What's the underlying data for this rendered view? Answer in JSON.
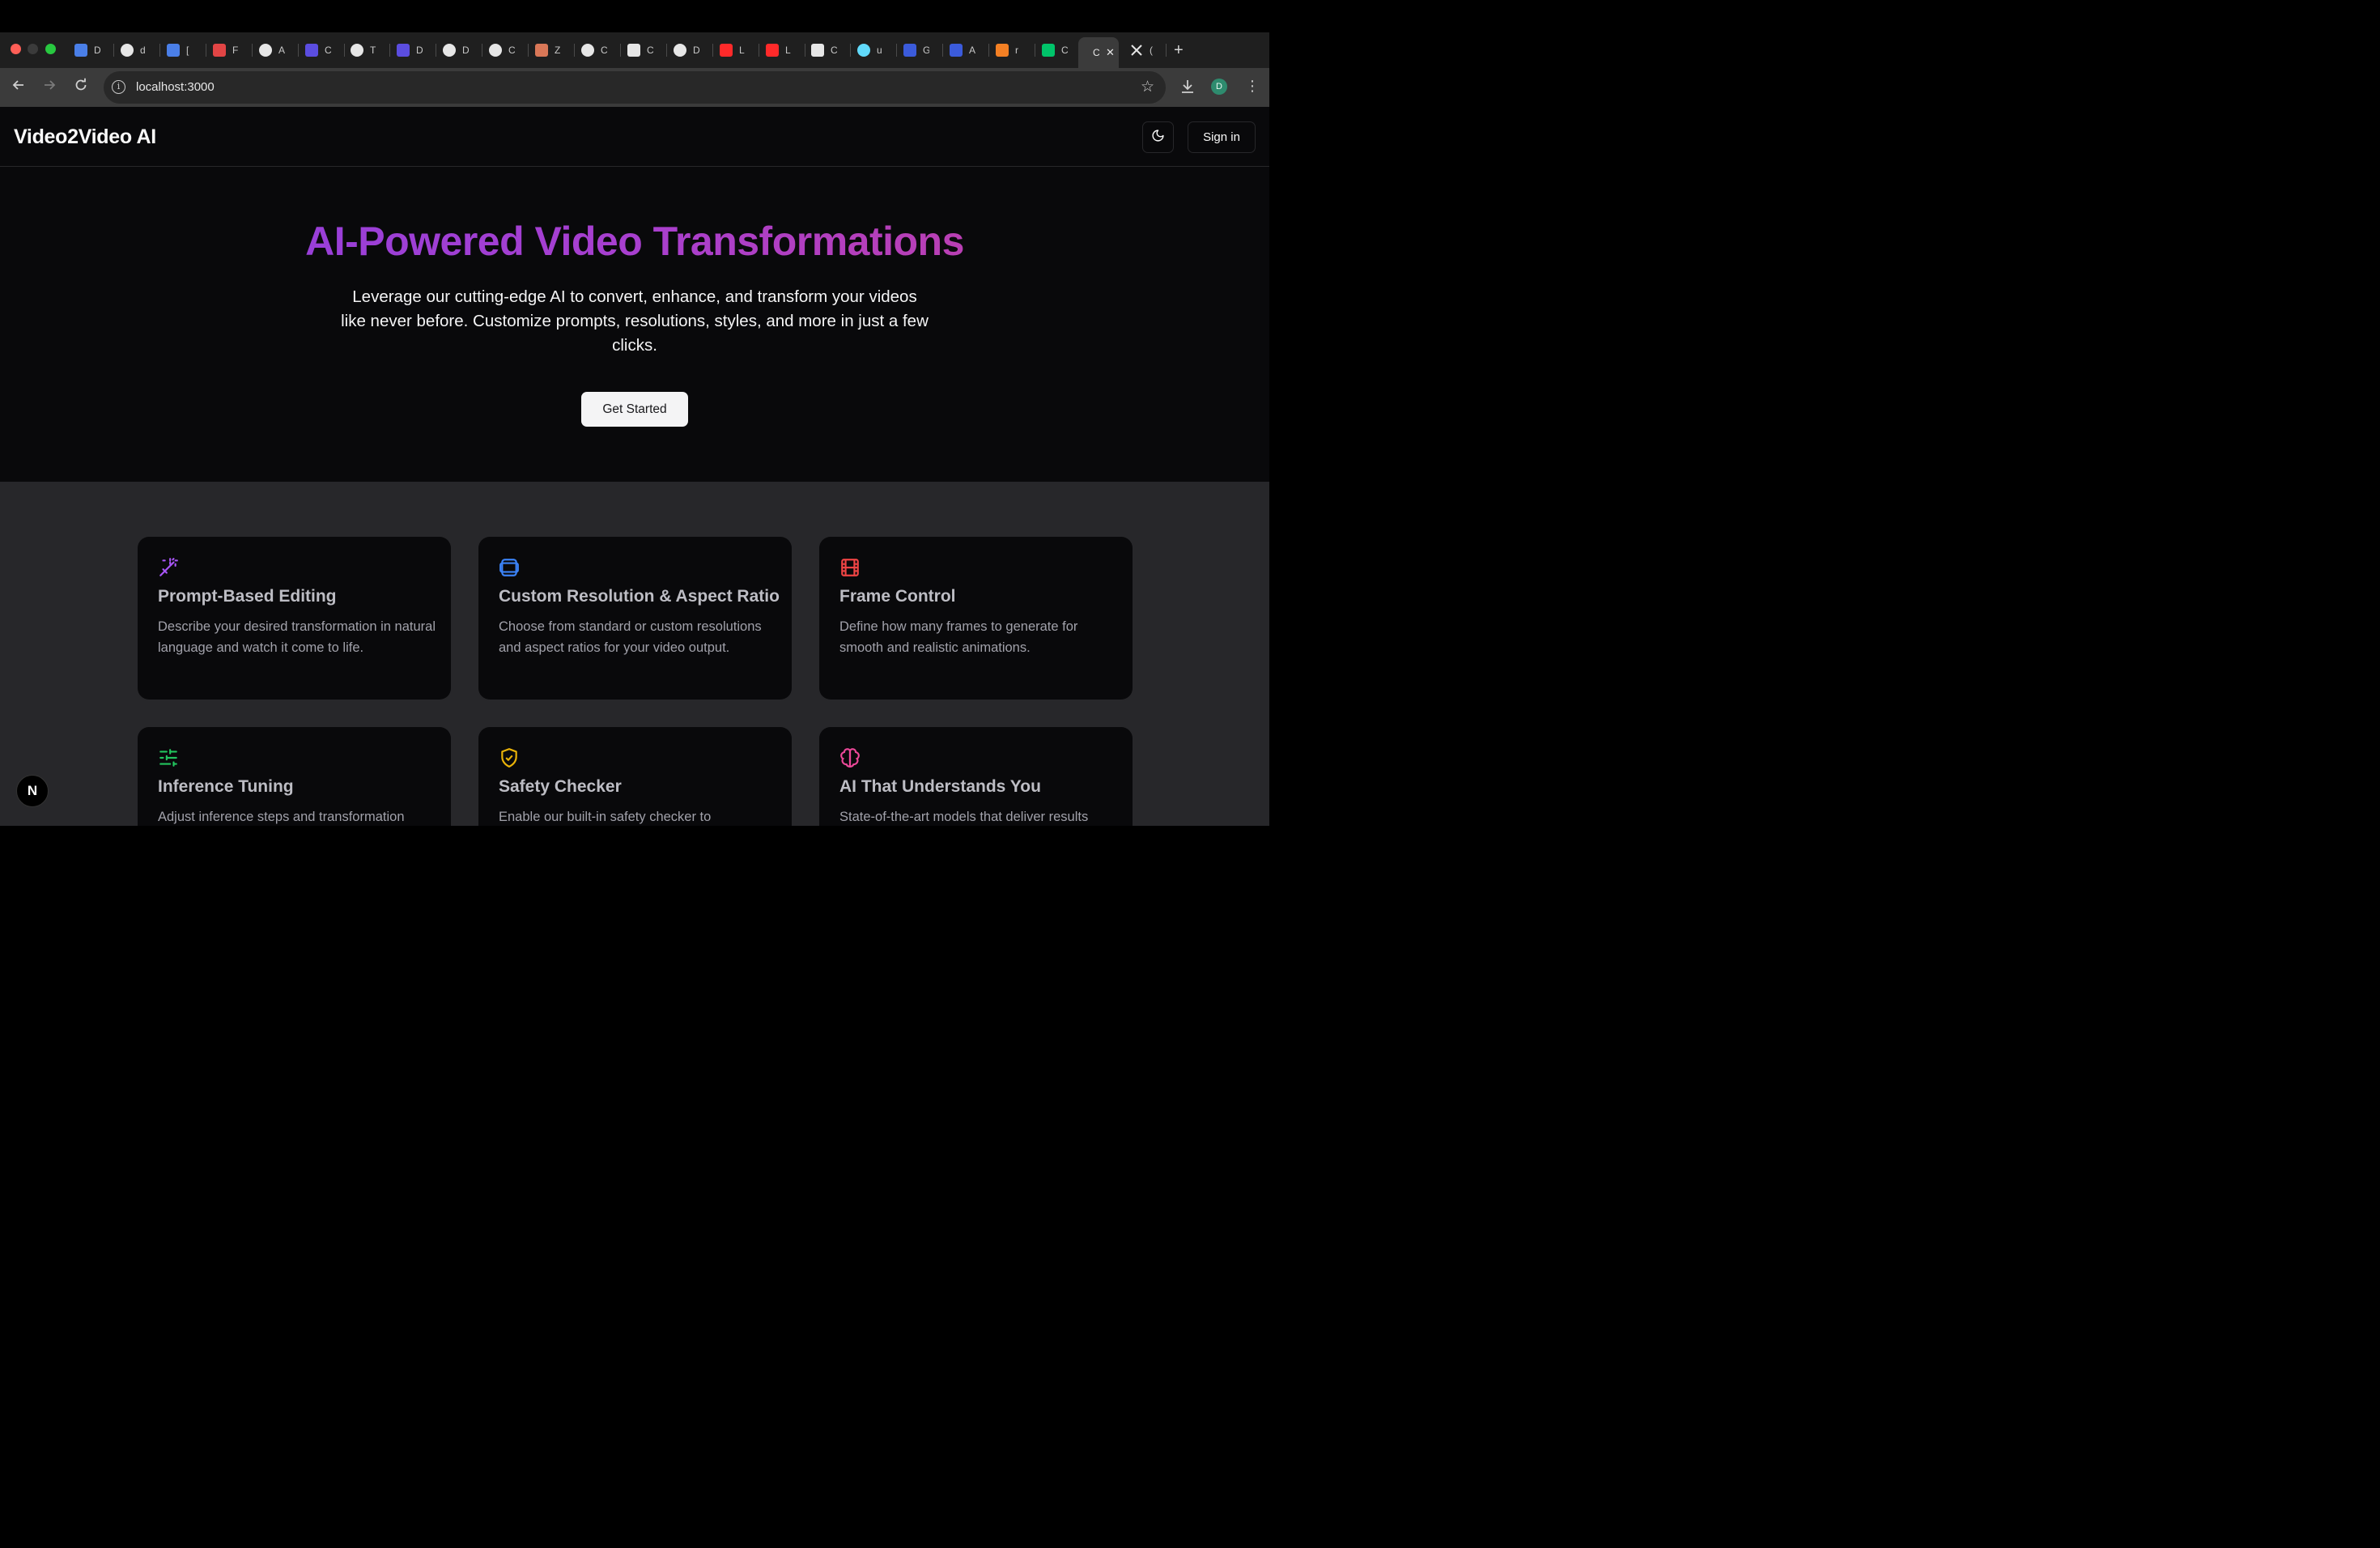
{
  "browser": {
    "tabs": [
      {
        "letter": "D",
        "icon": "docs-icon",
        "color": "#4a7fe8"
      },
      {
        "letter": "d",
        "icon": "github-icon",
        "color": "#e6e6e6"
      },
      {
        "letter": "[",
        "icon": "docs-icon",
        "color": "#4a7fe8"
      },
      {
        "letter": "F",
        "icon": "lifebuoy-icon",
        "color": "#e24545"
      },
      {
        "letter": "A",
        "icon": "openai-icon",
        "color": "#e6e6e6"
      },
      {
        "letter": "C",
        "icon": "copilot-icon",
        "color": "#5b4de0"
      },
      {
        "letter": "T",
        "icon": "cursor-icon",
        "color": "#e6e6e6"
      },
      {
        "letter": "D",
        "icon": "copilot-icon",
        "color": "#5b4de0"
      },
      {
        "letter": "D",
        "icon": "cursor-icon",
        "color": "#e6e6e6"
      },
      {
        "letter": "C",
        "icon": "cursor-icon",
        "color": "#e6e6e6"
      },
      {
        "letter": "Z",
        "icon": "claude-icon",
        "color": "#d97757"
      },
      {
        "letter": "C",
        "icon": "openai-icon",
        "color": "#e6e6e6"
      },
      {
        "letter": "C",
        "icon": "slash-icon",
        "color": "#e6e6e6"
      },
      {
        "letter": "D",
        "icon": "notion-icon",
        "color": "#e6e6e6"
      },
      {
        "letter": "L",
        "icon": "youtube-icon",
        "color": "#ff2a2a"
      },
      {
        "letter": "L",
        "icon": "youtube-icon",
        "color": "#ff2a2a"
      },
      {
        "letter": "C",
        "icon": "cloud-icon",
        "color": "#e6e6e6"
      },
      {
        "letter": "u",
        "icon": "react-icon",
        "color": "#61dafb"
      },
      {
        "letter": "G",
        "icon": "cloud-icon",
        "color": "#3b5bdb"
      },
      {
        "letter": "A",
        "icon": "cloud-icon",
        "color": "#3b5bdb"
      },
      {
        "letter": "r",
        "icon": "stackoverflow-icon",
        "color": "#f48024"
      },
      {
        "letter": "C",
        "icon": "leaf-icon",
        "color": "#00c46a"
      }
    ],
    "active_tab": {
      "letter": "C"
    },
    "after_tab": {
      "letter": "(",
      "icon": "x-icon"
    },
    "url": "localhost:3000",
    "profile_initial": "D"
  },
  "header": {
    "brand": "Video2Video AI",
    "signin_label": "Sign in"
  },
  "hero": {
    "title": "AI-Powered Video Transformations",
    "subtitle": "Leverage our cutting-edge AI to convert, enhance, and transform your videos like never before. Customize prompts, resolutions, styles, and more in just a few clicks.",
    "cta_label": "Get Started"
  },
  "features": [
    {
      "title": "Prompt-Based Editing",
      "description": "Describe your desired transformation in natural language and watch it come to life.",
      "icon": "magic-wand-icon",
      "color": "#a855f7"
    },
    {
      "title": "Custom Resolution & Aspect Ratio",
      "description": "Choose from standard or custom resolutions and aspect ratios for your video output.",
      "icon": "layers-icon",
      "color": "#3b82f6"
    },
    {
      "title": "Frame Control",
      "description": "Define how many frames to generate for smooth and realistic animations.",
      "icon": "film-icon",
      "color": "#ef4444"
    },
    {
      "title": "Inference Tuning",
      "description": "Adjust inference steps and transformation",
      "icon": "sliders-icon",
      "color": "#22c55e"
    },
    {
      "title": "Safety Checker",
      "description": "Enable our built-in safety checker to",
      "icon": "shield-check-icon",
      "color": "#eab308"
    },
    {
      "title": "AI That Understands You",
      "description": "State-of-the-art models that deliver results",
      "icon": "brain-icon",
      "color": "#ec4899"
    }
  ],
  "dev_badge": {
    "letter": "N"
  }
}
